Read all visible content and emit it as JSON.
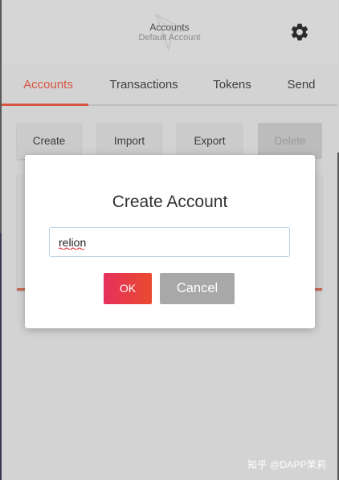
{
  "header": {
    "title": "Accounts",
    "subtitle": "Default Account",
    "icon": "gear-icon"
  },
  "tabs": [
    {
      "label": "Accounts",
      "active": true
    },
    {
      "label": "Transactions",
      "active": false
    },
    {
      "label": "Tokens",
      "active": false
    },
    {
      "label": "Send",
      "active": false
    }
  ],
  "actions": [
    {
      "label": "Create",
      "enabled": true
    },
    {
      "label": "Import",
      "enabled": true
    },
    {
      "label": "Export",
      "enabled": true
    },
    {
      "label": "Delete",
      "enabled": false
    }
  ],
  "modal": {
    "title": "Create Account",
    "input_value": "relion",
    "ok_label": "OK",
    "cancel_label": "Cancel"
  },
  "watermark": "知乎 @DAPP茉莉",
  "colors": {
    "accent": "#d8553f",
    "ok_start": "#e6305e",
    "ok_end": "#ea4a2e",
    "cancel": "#a8a8a8"
  }
}
